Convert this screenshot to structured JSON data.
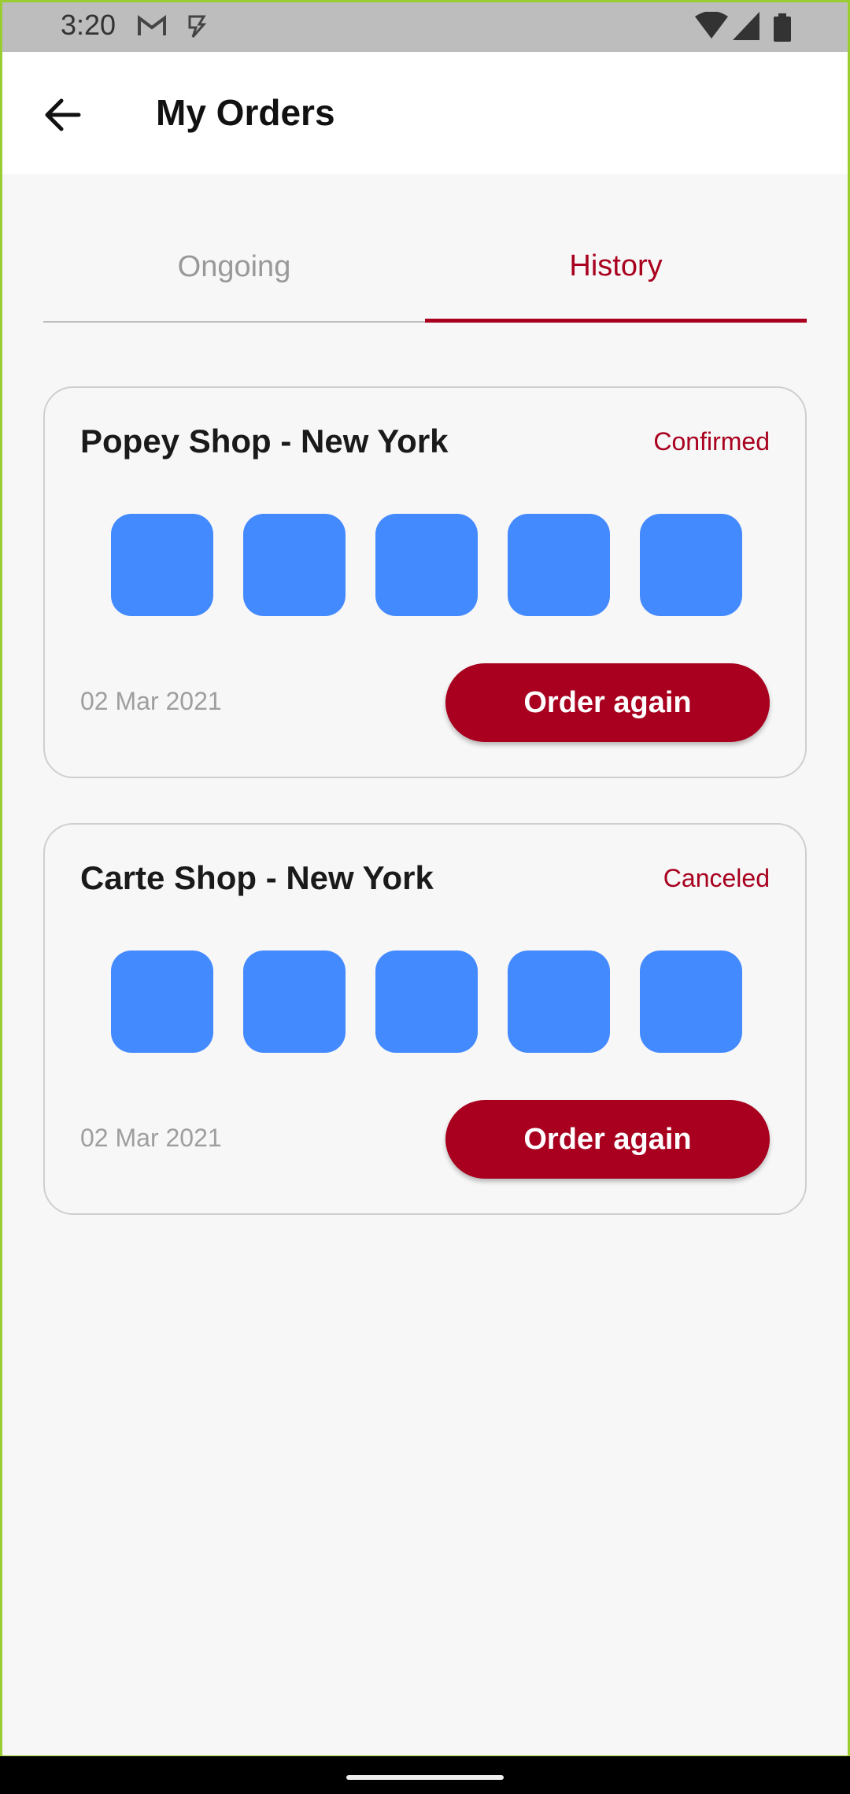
{
  "status_bar": {
    "time": "3:20",
    "icons": [
      "gmail-icon",
      "sim-icon",
      "wifi-icon",
      "signal-icon",
      "battery-icon"
    ]
  },
  "app_bar": {
    "title": "My Orders",
    "back_icon": "arrow-left-icon"
  },
  "tabs": [
    {
      "label": "Ongoing",
      "active": false
    },
    {
      "label": "History",
      "active": true
    }
  ],
  "orders": [
    {
      "shop": "Popey Shop - New York",
      "status": "Confirmed",
      "date": "02 Mar 2021",
      "button": "Order again",
      "items": 5
    },
    {
      "shop": "Carte Shop - New York",
      "status": "Canceled",
      "date": "02 Mar 2021",
      "button": "Order again",
      "items": 5
    }
  ],
  "colors": {
    "accent": "#A8001E",
    "thumbnail": "#448AFF",
    "background": "#F7F7F7"
  }
}
